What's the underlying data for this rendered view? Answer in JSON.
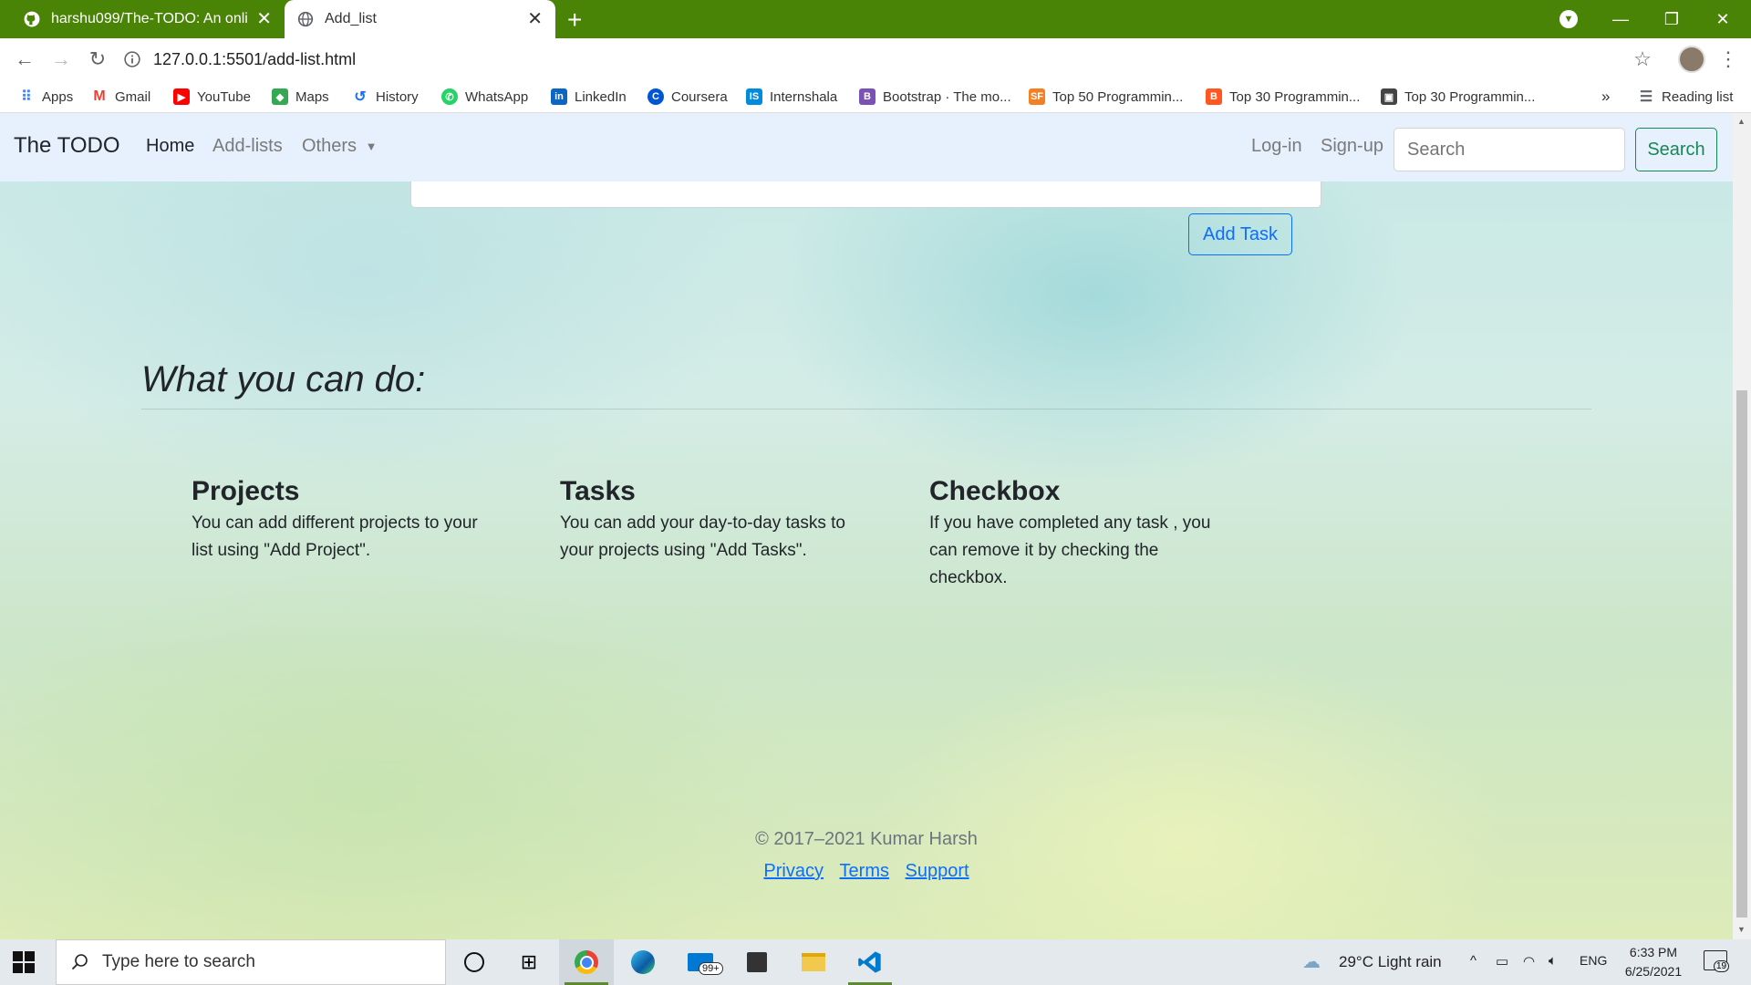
{
  "browser": {
    "tabs": [
      {
        "label": "harshu099/The-TODO: An online",
        "active": false,
        "icon": "github-icon"
      },
      {
        "label": "Add_list",
        "active": true,
        "icon": "globe-icon"
      }
    ],
    "new_tab": "+",
    "url": "127.0.0.1:5501/add-list.html",
    "bookmarks": [
      {
        "label": "Apps",
        "icon": "apps-grid-icon",
        "color": "#4285f4"
      },
      {
        "label": "Gmail",
        "icon": "gmail-icon",
        "color": "#ea4335"
      },
      {
        "label": "YouTube",
        "icon": "youtube-icon",
        "color": "#ff0000"
      },
      {
        "label": "Maps",
        "icon": "maps-icon",
        "color": "#34a853"
      },
      {
        "label": "History",
        "icon": "history-icon",
        "color": "#1a73e8"
      },
      {
        "label": "WhatsApp",
        "icon": "whatsapp-icon",
        "color": "#25d366"
      },
      {
        "label": "LinkedIn",
        "icon": "linkedin-icon",
        "color": "#0a66c2"
      },
      {
        "label": "Coursera",
        "icon": "coursera-icon",
        "color": "#0056d2"
      },
      {
        "label": "Internshala",
        "icon": "internshala-icon",
        "color": "#008bdc"
      },
      {
        "label": "Bootstrap · The mo...",
        "icon": "bootstrap-icon",
        "color": "#7952b3"
      },
      {
        "label": "Top 50 Programmin...",
        "icon": "sf-icon",
        "color": "#f48024"
      },
      {
        "label": "Top 30 Programmin...",
        "icon": "blogger-icon",
        "color": "#ff5722"
      },
      {
        "label": "Top 30 Programmin...",
        "icon": "page-icon",
        "color": "#444444"
      }
    ],
    "more": "»",
    "reading_list": "Reading list"
  },
  "navbar": {
    "brand": "The TODO",
    "links": [
      {
        "label": "Home",
        "active": true
      },
      {
        "label": "Add-lists",
        "active": false
      },
      {
        "label": "Others",
        "active": false
      }
    ],
    "login": "Log-in",
    "signup": "Sign-up",
    "search_placeholder": "Search",
    "search_button": "Search"
  },
  "form": {
    "add_task": "Add Task"
  },
  "features": {
    "heading": "What you can do:",
    "items": [
      {
        "title": "Projects",
        "text": "You can add different projects to your list using \"Add Project\"."
      },
      {
        "title": "Tasks",
        "text": "You can add your day-to-day tasks to your projects using \"Add Tasks\"."
      },
      {
        "title": "Checkbox",
        "text": "If you have completed any task , you can remove it by checking the checkbox."
      }
    ]
  },
  "footer": {
    "copyright": "© 2017–2021 Kumar Harsh",
    "links": [
      "Privacy",
      "Terms",
      "Support"
    ]
  },
  "taskbar": {
    "search_placeholder": "Type here to search",
    "mail_badge": "99+",
    "weather": "29°C  Light rain",
    "language": "ENG",
    "time": "6:33 PM",
    "date": "6/25/2021",
    "notifications": "19"
  },
  "colors": {
    "tab_strip": "#4a8407",
    "navbar_bg": "#e7f1fd",
    "primary": "#0d6efd",
    "success": "#198754"
  }
}
